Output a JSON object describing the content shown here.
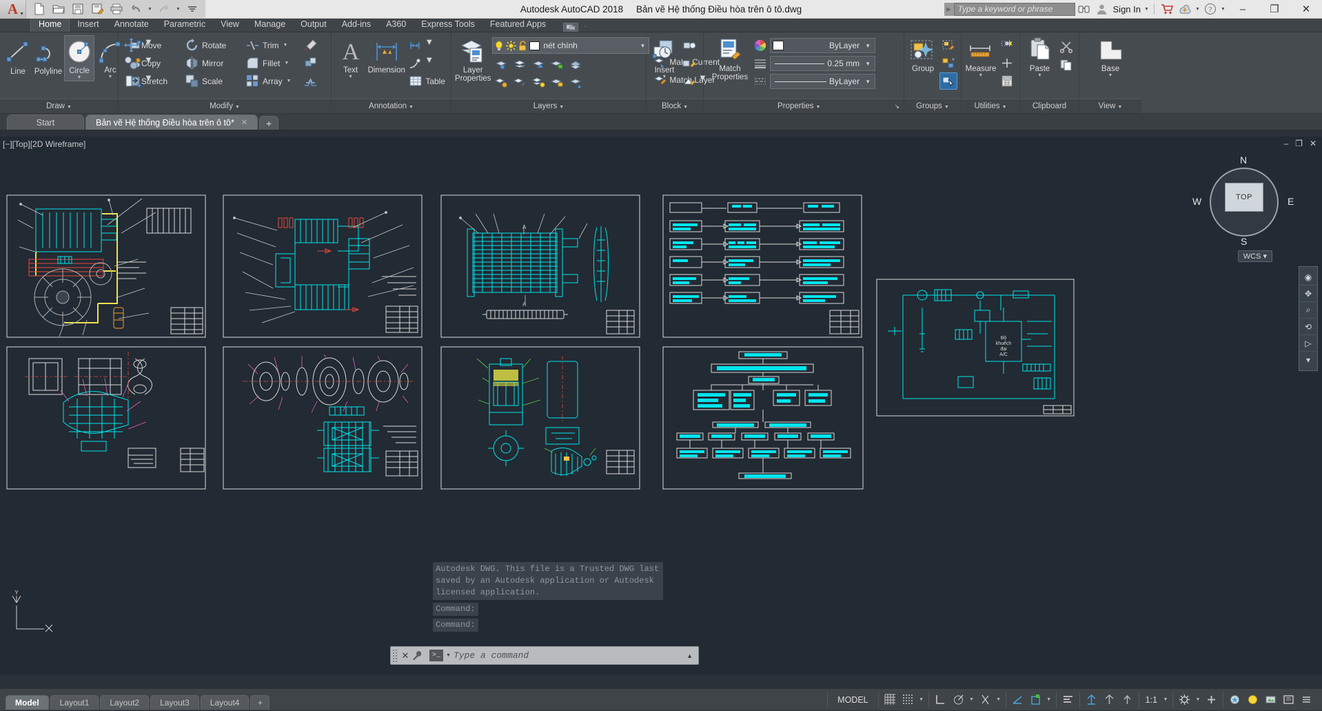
{
  "titlebar": {
    "app_title": "Autodesk AutoCAD 2018",
    "document_title": "Bản vẽ Hệ thống Điều hòa trên ô tô.dwg",
    "search_placeholder": "Type a keyword or phrase",
    "signin_label": "Sign In",
    "quick_access": [
      {
        "name": "new-file",
        "glyph": "🗋"
      },
      {
        "name": "open-file",
        "glyph": "📂"
      },
      {
        "name": "save-file",
        "glyph": "💾"
      },
      {
        "name": "save-as-file",
        "glyph": "📝"
      },
      {
        "name": "plot",
        "glyph": "🖨"
      },
      {
        "name": "undo",
        "glyph": "↶"
      },
      {
        "name": "redo",
        "glyph": "↷"
      }
    ],
    "window_buttons": {
      "minimize": "–",
      "maximize": "❐",
      "close": "✕"
    }
  },
  "ribbon": {
    "tabs": [
      "Home",
      "Insert",
      "Annotate",
      "Parametric",
      "View",
      "Manage",
      "Output",
      "Add-ins",
      "A360",
      "Express Tools",
      "Featured Apps"
    ],
    "active_tab": "Home",
    "panels": {
      "draw": {
        "title": "Draw",
        "line": "Line",
        "polyline": "Polyline",
        "circle": "Circle",
        "arc": "Arc"
      },
      "modify": {
        "title": "Modify",
        "move": "Move",
        "rotate": "Rotate",
        "trim": "Trim",
        "copy": "Copy",
        "mirror": "Mirror",
        "fillet": "Fillet",
        "stretch": "Stretch",
        "scale": "Scale",
        "array": "Array"
      },
      "annotation": {
        "title": "Annotation",
        "text": "Text",
        "dimension": "Dimension",
        "table": "Table"
      },
      "layers": {
        "title": "Layers",
        "layer_properties": "Layer\nProperties",
        "layer_properties_l1": "Layer",
        "layer_properties_l2": "Properties",
        "current_layer": "nét chính",
        "make_current": "Make Current",
        "match_layer": "Match Layer"
      },
      "block": {
        "title": "Block",
        "insert": "Insert"
      },
      "properties": {
        "title": "Properties",
        "match_properties_l1": "Match",
        "match_properties_l2": "Properties",
        "color": "ByLayer",
        "lineweight": "0.25 mm",
        "linetype": "ByLayer"
      },
      "groups": {
        "title": "Groups",
        "group": "Group"
      },
      "utilities": {
        "title": "Utilities",
        "measure": "Measure"
      },
      "clipboard": {
        "title": "Clipboard",
        "paste": "Paste"
      },
      "view": {
        "title": "View",
        "base": "Base"
      }
    }
  },
  "file_tabs": {
    "start": "Start",
    "document": "Bản vẽ Hệ thống Điều hòa trên ô tô*",
    "close_glyph": "✕",
    "new_glyph": "+"
  },
  "viewport": {
    "label": "[−][Top][2D Wireframe]",
    "minimize": "–",
    "maximize": "❐",
    "close": "✕",
    "viewcube": {
      "top": "TOP",
      "n": "N",
      "s": "S",
      "w": "W",
      "e": "E"
    },
    "wcs": "WCS"
  },
  "command_line": {
    "history": [
      "Autodesk DWG.  This file is a Trusted DWG last",
      "saved by an Autodesk application or Autodesk",
      "licensed application."
    ],
    "prompts": [
      "Command:",
      "Command:"
    ],
    "placeholder": "Type a command",
    "prompt_glyph": ">_",
    "close_glyph": "✕"
  },
  "status_bar": {
    "layout_tabs": [
      "Model",
      "Layout1",
      "Layout2",
      "Layout3",
      "Layout4"
    ],
    "active_layout": "Model",
    "add_layout_glyph": "+",
    "space_label": "MODEL",
    "scale": "1:1",
    "toggles": [
      {
        "name": "grid-display",
        "glyph": "▦",
        "on": false
      },
      {
        "name": "snap-mode",
        "glyph": "∷",
        "on": false
      },
      {
        "name": "ortho-mode",
        "glyph": "∟",
        "on": false
      },
      {
        "name": "polar-tracking",
        "glyph": "⥁",
        "on": false
      },
      {
        "name": "object-snap",
        "glyph": "∠",
        "on": true
      },
      {
        "name": "object-snap-tracking",
        "glyph": "▣",
        "on": true
      },
      {
        "name": "annotation-visibility",
        "glyph": "≡",
        "on": false
      },
      {
        "name": "annotation-scale",
        "glyph": "↯",
        "on": true
      }
    ]
  },
  "drawing": {
    "title": "Bản vẽ Hệ thống Điều hòa trên ô tô",
    "accent_cyan": "#00e5ee",
    "accent_yellow": "#f0e24a",
    "accent_red": "#e8483c",
    "accent_green": "#5ac24a",
    "accent_magenta": "#e060c0",
    "background": "#222a33",
    "block_label": "Bộ khuếch đại A/C"
  }
}
